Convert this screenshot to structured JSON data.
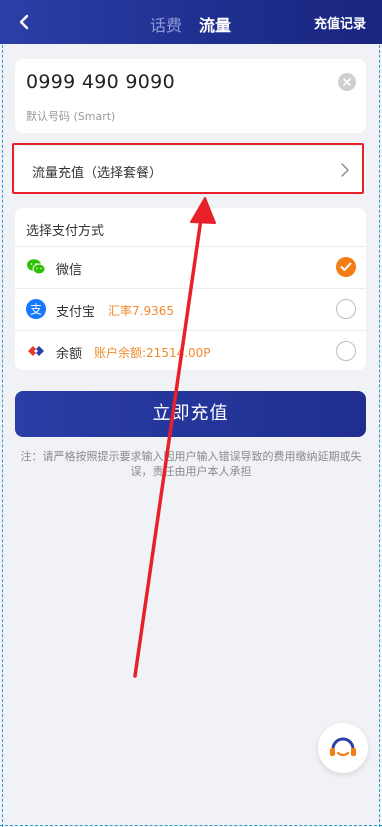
{
  "header": {
    "tabs": [
      {
        "label": "话费",
        "active": false
      },
      {
        "label": "流量",
        "active": true
      }
    ],
    "history_label": "充值记录"
  },
  "phone": {
    "number": "0999 490 9090",
    "carrier": "默认号码 (Smart)"
  },
  "package": {
    "label": "流量充值（选择套餐）"
  },
  "payment": {
    "title": "选择支付方式",
    "methods": [
      {
        "name": "微信",
        "extra": "",
        "selected": true,
        "icon": "wechat-icon",
        "color": "#2dc100"
      },
      {
        "name": "支付宝",
        "extra": "汇率7.9365",
        "selected": false,
        "icon": "alipay-icon",
        "color": "#1677ff"
      },
      {
        "name": "余额",
        "extra": "账户余额:21514.00P",
        "selected": false,
        "icon": "balance-icon",
        "color": "#e8392b"
      }
    ]
  },
  "submit_label": "立即充值",
  "note": "注：请严格按照提示要求输入因用户输入错误导致的费用缴纳延期或失误，责任由用户本人承担",
  "colors": {
    "header": "#1f2f8f",
    "accent": "#f37d14",
    "annotation": "#e8202a"
  }
}
